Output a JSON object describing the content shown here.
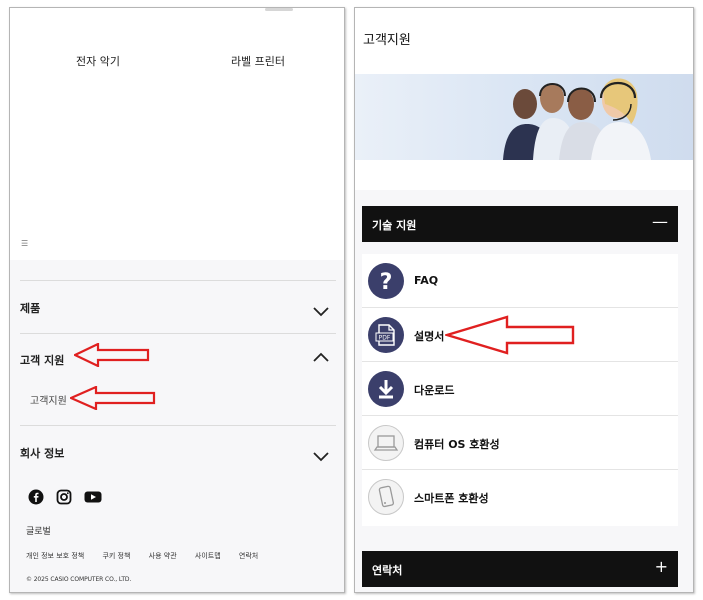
{
  "left": {
    "categories": [
      "전자 악기",
      "라벨 프린터"
    ],
    "menu_glyph": "☰",
    "accordion": [
      {
        "title": "제품",
        "state": "collapsed"
      },
      {
        "title": "고객 지원",
        "state": "expanded",
        "sub": "고객지원"
      },
      {
        "title": "회사 정보",
        "state": "collapsed"
      }
    ],
    "social_icons": [
      "facebook-icon",
      "instagram-icon",
      "youtube-icon"
    ],
    "global_label": "글로벌",
    "footer_links": [
      "개인 정보 보호 정책",
      "쿠키 정책",
      "사용 약관",
      "사이트맵",
      "연락처"
    ],
    "copyright": "© 2025 CASIO COMPUTER CO., LTD."
  },
  "right": {
    "title": "고객지원",
    "section_bar": {
      "label": "기술 지원",
      "toggle": "—"
    },
    "items": [
      {
        "label": "FAQ",
        "icon": "question-icon",
        "style": "dark"
      },
      {
        "label": "설명서",
        "icon": "pdf-icon",
        "style": "dark"
      },
      {
        "label": "다운로드",
        "icon": "download-icon",
        "style": "dark"
      },
      {
        "label": "컴퓨터 OS 호환성",
        "icon": "laptop-icon",
        "style": "light"
      },
      {
        "label": "스마트폰 호환성",
        "icon": "smartphone-icon",
        "style": "light"
      }
    ],
    "contact_bar": {
      "label": "연락처",
      "toggle": "+"
    }
  },
  "colors": {
    "annotation_arrow": "#e02020",
    "bar_bg": "#111111",
    "icon_dark": "#3b3f6b"
  }
}
